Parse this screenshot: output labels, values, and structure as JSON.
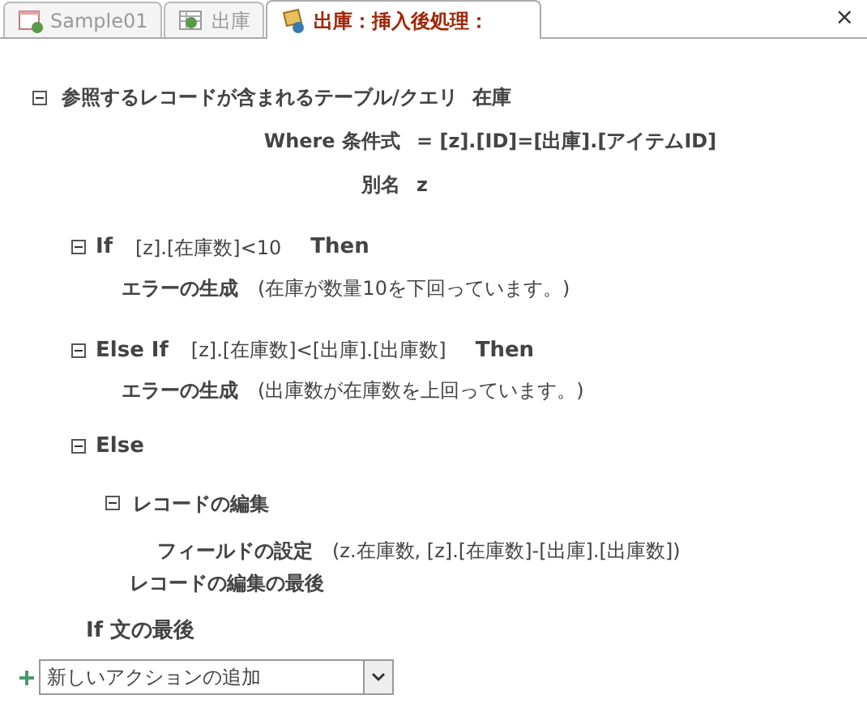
{
  "tabs": [
    {
      "label": "Sample01",
      "selected": false,
      "kind": "form"
    },
    {
      "label": "出庫",
      "selected": false,
      "kind": "table"
    },
    {
      "label": "出庫：挿入後処理：",
      "selected": true,
      "kind": "macro"
    }
  ],
  "close": "×",
  "lookup": {
    "expanded": true,
    "label": "参照するレコードが含まれるテーブル/クエリ",
    "value": "在庫",
    "rows": [
      {
        "label": "Where 条件式",
        "value": "= [z].[ID]=[出庫].[アイテムID]"
      },
      {
        "label": "別名",
        "value": "z"
      }
    ]
  },
  "branches": [
    {
      "expanded": true,
      "keyword": "If",
      "condition": "[z].[在庫数]<10",
      "then": "Then",
      "action": {
        "name": "エラーの生成",
        "args": "(在庫が数量10を下回っています。)"
      }
    },
    {
      "expanded": true,
      "keyword": "Else If",
      "condition": "[z].[在庫数]<[出庫].[出庫数]",
      "then": "Then",
      "action": {
        "name": "エラーの生成",
        "args": "(出庫数が在庫数を上回っています。)"
      }
    }
  ],
  "else": {
    "expanded": true,
    "keyword": "Else",
    "edit": {
      "expanded": true,
      "title": "レコードの編集",
      "action": {
        "name": "フィールドの設定",
        "args": "(z.在庫数, [z].[在庫数]-[出庫].[出庫数])"
      },
      "end": "レコードの編集の最後"
    }
  },
  "end_if": "If 文の最後",
  "add_action": {
    "placeholder": "新しいアクションの追加"
  }
}
